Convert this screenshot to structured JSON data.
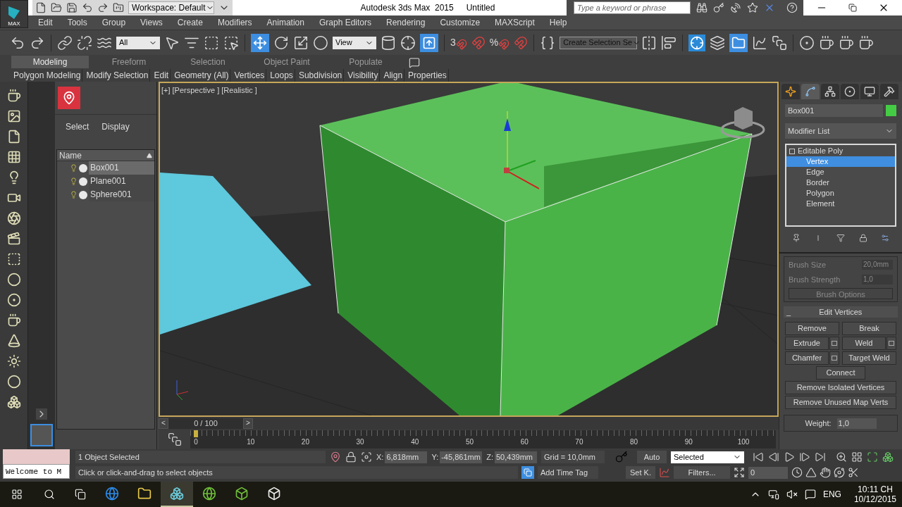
{
  "title_bar": {
    "app_menu": "MAX",
    "workspace": "Workspace: Default",
    "title": "Autodesk 3ds Max  2015",
    "document": "Untitled",
    "search": {
      "placeholder": "Type a keyword or phrase"
    }
  },
  "menu": [
    "Edit",
    "Tools",
    "Group",
    "Views",
    "Create",
    "Modifiers",
    "Animation",
    "Graph Editors",
    "Rendering",
    "Customize",
    "MAXScript",
    "Help"
  ],
  "toolbar": {
    "selection_filter": "All",
    "reference_coord": "View",
    "snap_labels": [
      "3",
      "%"
    ],
    "named_selection": "Create Selection Se"
  },
  "ribbon": {
    "tabs": [
      {
        "label": "Modeling",
        "selected": true
      },
      {
        "label": "Freeform",
        "selected": false
      },
      {
        "label": "Selection",
        "selected": false
      },
      {
        "label": "Object Paint",
        "selected": false
      },
      {
        "label": "Populate",
        "selected": false
      }
    ],
    "panels": [
      "Polygon Modeling",
      "Modify Selection",
      "Edit",
      "Geometry (All)",
      "Vertices",
      "Loops",
      "Subdivision",
      "Visibility",
      "Align",
      "Properties"
    ]
  },
  "scene_explorer": {
    "menus": [
      "Select",
      "Display"
    ],
    "column": "Name",
    "objects": [
      {
        "name": "Box001",
        "selected": true
      },
      {
        "name": "Plane001",
        "selected": false
      },
      {
        "name": "Sphere001",
        "selected": false
      }
    ]
  },
  "viewport": {
    "labels": [
      "[+]",
      "[Perspective ]",
      "[Realistic ]"
    ]
  },
  "command_panel": {
    "tabs": [
      {
        "selected": false
      },
      {
        "selected": true
      },
      {
        "selected": false
      },
      {
        "selected": false
      },
      {
        "selected": false
      },
      {
        "selected": false
      }
    ],
    "object_name": "Box001",
    "modifier_list": "Modifier List",
    "stack": [
      {
        "label": "Editable Poly",
        "selected": false,
        "children": [
          {
            "label": "Vertex",
            "selected": true
          },
          {
            "label": "Edge",
            "selected": false
          },
          {
            "label": "Border",
            "selected": false
          },
          {
            "label": "Polygon",
            "selected": false
          },
          {
            "label": "Element",
            "selected": false
          }
        ]
      }
    ],
    "paint": {
      "disabled": true,
      "brush_size_label": "Brush Size",
      "brush_size": "20,0mm",
      "brush_strength_label": "Brush Strength",
      "brush_strength": "1,0",
      "options": "Brush Options"
    },
    "edit_vertices": {
      "collapse": "_",
      "title": "Edit Vertices",
      "rows": [
        [
          {
            "label": "Remove",
            "settings": false
          },
          {
            "label": "Break",
            "settings": false
          }
        ],
        [
          {
            "label": "Extrude",
            "settings": true
          },
          {
            "label": "Weld",
            "settings": true
          }
        ],
        [
          {
            "label": "Chamfer",
            "settings": true
          },
          {
            "label": "Target Weld",
            "settings": false
          }
        ],
        [
          {
            "label": "Connect",
            "settings": false
          }
        ],
        [
          {
            "label": "Remove Isolated Vertices",
            "settings": false
          }
        ],
        [
          {
            "label": "Remove Unused Map Verts",
            "settings": false
          }
        ]
      ],
      "weight_label": "Weight:",
      "weight": "1,0"
    }
  },
  "timeline": {
    "prev": "<",
    "frame": "0 / 100",
    "next": ">",
    "level": 0,
    "ticks": [
      "0",
      "10",
      "20",
      "30",
      "40",
      "50",
      "60",
      "70",
      "80",
      "90",
      "100"
    ]
  },
  "status": {
    "listener": "Welcome to M",
    "selection": "1 Object Selected",
    "prompt": "Click or click-and-drag to select objects",
    "coords": [
      {
        "label": "X:",
        "value": "6,818mm"
      },
      {
        "label": "Y:",
        "value": "-45,861mm"
      },
      {
        "label": "Z:",
        "value": "50,439mm"
      }
    ],
    "grid": "Grid = 10,0mm",
    "add_time_tag": "Add Time Tag",
    "auto": "Auto",
    "set_key": "Set K.",
    "key_filter": "Selected",
    "filters": "Filters...",
    "frame": "0"
  },
  "taskbar": {
    "apps": [
      {
        "selected": false
      },
      {
        "selected": false
      },
      {
        "selected": true
      },
      {
        "selected": false
      },
      {
        "selected": false
      },
      {
        "selected": false
      }
    ],
    "language": "ENG",
    "time": "10:11 CH",
    "date": "10/12/2015"
  }
}
